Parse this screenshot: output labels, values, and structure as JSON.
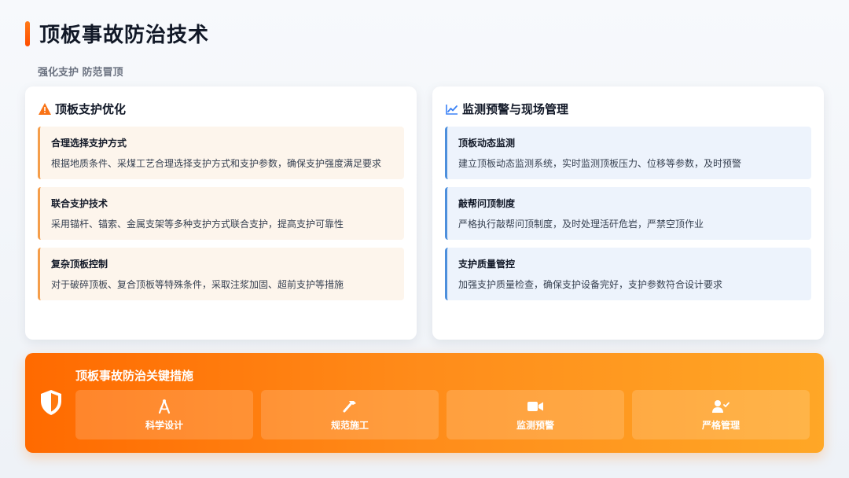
{
  "header": {
    "title": "顶板事故防治技术",
    "subtitle": "强化支护 防范冒顶"
  },
  "left_panel": {
    "title": "顶板支护优化",
    "icon": "warning-triangle-icon",
    "items": [
      {
        "title": "合理选择支护方式",
        "desc": "根据地质条件、采煤工艺合理选择支护方式和支护参数，确保支护强度满足要求"
      },
      {
        "title": "联合支护技术",
        "desc": "采用锚杆、锚索、金属支架等多种支护方式联合支护，提高支护可靠性"
      },
      {
        "title": "复杂顶板控制",
        "desc": "对于破碎顶板、复合顶板等特殊条件，采取注浆加固、超前支护等措施"
      }
    ]
  },
  "right_panel": {
    "title": "监测预警与现场管理",
    "icon": "line-chart-icon",
    "items": [
      {
        "title": "顶板动态监测",
        "desc": "建立顶板动态监测系统，实时监测顶板压力、位移等参数，及时预警"
      },
      {
        "title": "敲帮问顶制度",
        "desc": "严格执行敲帮问顶制度，及时处理活矸危岩，严禁空顶作业"
      },
      {
        "title": "支护质量管控",
        "desc": "加强支护质量检查，确保支护设备完好，支护参数符合设计要求"
      }
    ]
  },
  "banner": {
    "title": "顶板事故防治关键措施",
    "icon": "shield-icon",
    "measures": [
      {
        "label": "科学设计",
        "icon": "drafting-compass-icon"
      },
      {
        "label": "规范施工",
        "icon": "hammer-icon"
      },
      {
        "label": "监测预警",
        "icon": "video-camera-icon"
      },
      {
        "label": "严格管理",
        "icon": "user-check-icon"
      }
    ]
  },
  "colors": {
    "accent": "#ff6a00",
    "left_item_bg": "#fdf5ec",
    "left_item_border": "#f59e4b",
    "right_item_bg": "#edf3fc",
    "right_item_border": "#4d8fdc"
  }
}
